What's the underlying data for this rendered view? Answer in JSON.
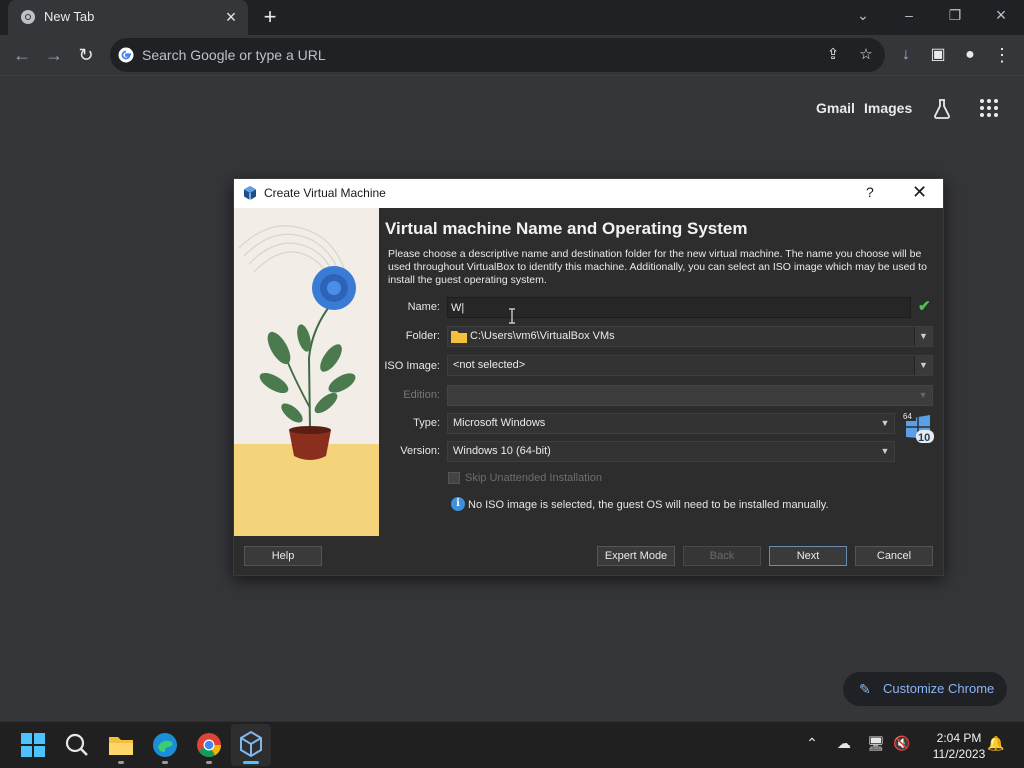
{
  "browser": {
    "tab_title": "New Tab",
    "omnibox_placeholder": "Search Google or type a URL",
    "ntp_links": {
      "gmail": "Gmail",
      "images": "Images"
    },
    "customize_label": "Customize Chrome"
  },
  "dialog": {
    "title": "Create Virtual Machine",
    "help_glyph": "?",
    "heading": "Virtual machine Name and Operating System",
    "description": "Please choose a descriptive name and destination folder for the new virtual machine. The name you choose will be used throughout VirtualBox to identify this machine. Additionally, you can select an ISO image which may be used to install the guest operating system.",
    "labels": {
      "name": "Name:",
      "folder": "Folder:",
      "iso": "ISO Image:",
      "edition": "Edition:",
      "type": "Type:",
      "version": "Version:"
    },
    "values": {
      "name": "W|",
      "folder": "C:\\Users\\vm6\\VirtualBox VMs",
      "iso": "<not selected>",
      "edition": "",
      "type": "Microsoft Windows",
      "version": "Windows 10 (64-bit)"
    },
    "skip_unattended_label": "Skip Unattended Installation",
    "info_message": "No ISO image is selected, the guest OS will need to be installed manually.",
    "os_badge": {
      "bits": "64",
      "version": "10"
    },
    "buttons": {
      "help": "Help",
      "expert": "Expert Mode",
      "back": "Back",
      "next": "Next",
      "cancel": "Cancel"
    }
  },
  "taskbar": {
    "time": "2:04 PM",
    "date": "11/2/2023"
  },
  "colors": {
    "chrome_bg": "#35363a",
    "dialog_bg": "#2d2d2d",
    "accent_blue": "#8ab4f8",
    "valid_green": "#53c24a"
  }
}
